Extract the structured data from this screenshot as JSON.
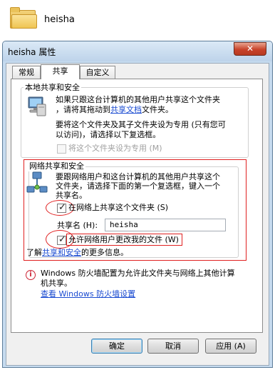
{
  "folder": {
    "name": "heisha"
  },
  "window": {
    "title": "heisha 属性",
    "close_glyph": "✕"
  },
  "tabs": [
    {
      "label": "常规"
    },
    {
      "label": "共享"
    },
    {
      "label": "自定义"
    }
  ],
  "local_sharing": {
    "legend": "本地共享和安全",
    "line1": "如果只跟这台计算机的其他用户共享这个文件夹",
    "line2_prefix": "，请将其拖动到",
    "line2_link": "共享文档",
    "line2_suffix": "文件夹。",
    "line3": "要将这个文件夹及其子文件夹设为专用 (只有您可",
    "line4": "以访问)，请选择以下复选框。",
    "private_checkbox": {
      "label": "将这个文件夹设为专用 (M)",
      "checked": false,
      "enabled": false
    }
  },
  "network_sharing": {
    "legend": "网络共享和安全",
    "line1": "要跟网络用户和这台计算机的其他用户共享这个",
    "line2": "文件夹，请选择下面的第一个复选框，键入一个",
    "line3": "共享名。",
    "share_checkbox": {
      "label": "在网络上共享这个文件夹 (S)",
      "checked": true
    },
    "share_name_label": "共享名 (H):",
    "share_name_value": "heisha",
    "allow_change_checkbox": {
      "label": "允许网络用户更改我的文件 (W)",
      "checked": true
    },
    "more_prefix": "了解",
    "more_link": "共享和安全",
    "more_suffix": "的更多信息。"
  },
  "firewall": {
    "line1": "Windows 防火墙配置为允许此文件夹与网络上其他计算",
    "line2": "机共享。",
    "link": "查看 Windows 防火墙设置"
  },
  "buttons": {
    "ok": "确定",
    "cancel": "取消",
    "apply": "应用 (A)"
  },
  "colors": {
    "highlight": "#e02020",
    "link": "#1a4bd1",
    "title_bar": "#c6dbef"
  }
}
